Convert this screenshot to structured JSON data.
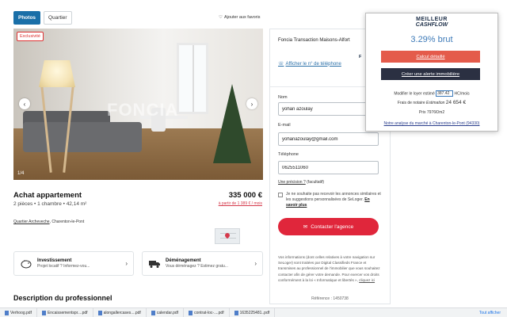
{
  "tabs": [
    "Photos",
    "Quartier"
  ],
  "favorite": "Ajouter aux favoris",
  "photo": {
    "badge": "Exclusivité",
    "counter": "1/4",
    "watermark": "FONCIA"
  },
  "listing": {
    "title": "Achat appartement",
    "details": "2 pièces • 1 chambre • 42,14 m²",
    "price": "335 000 €",
    "loan": "à partir de 1 389 € / mois",
    "location_link": "Quartier Archeveche",
    "location_city": ", Charenton-le-Pont"
  },
  "cards": [
    {
      "title": "Investissement",
      "subtitle": "Projet locatif ? Informez-vou..."
    },
    {
      "title": "Déménagement",
      "subtitle": "Vous déménagez ? Estimez gratu..."
    }
  ],
  "section_title": "Description du professionnel",
  "agency": {
    "name": "Foncia Transaction Maisons-Alfort",
    "logo": "F",
    "phone_link": "Afficher le n° de téléphone"
  },
  "form": {
    "name_label": "Nom",
    "name_value": "yohan azoulay",
    "email_label": "E-mail",
    "email_value": "yohanazoulay@gmail.com",
    "phone_label": "Téléphone",
    "phone_value": "0625511060",
    "precision_link": "Une précision ?",
    "precision_optional": " (facultatif)",
    "consent_text": "Je ne souhaite pas recevoir les annonces similaires et les suggestions personnalisées de SeLoger.",
    "consent_more": "En savoir plus",
    "contact_button": "Contacter l'agence",
    "legal_text": "Vos informations (dont celles relatives à votre navigation sur SeLoger) sont traitées par Digital Classifieds France et transmises au professionnel de l'immobilier que vous souhaitez contacter afin de gérer votre demande. Pour exercer vos droits conformément à la loi « Informatique et libertés »,",
    "legal_link": "cliquez ici",
    "reference": "Référence : 1450738"
  },
  "extension": {
    "logo_line1": "MEILLEUR",
    "logo_line2": "CASHFLOW",
    "yield": "3.29% brut",
    "detail_button": "Calcul détaillé",
    "alert_button": "Créer une alerte immobilière",
    "rent_label": "Modifier le loyer estimé",
    "rent_value": "387.42",
    "rent_unit": "HC/mois",
    "notary_label": "Frais de notaire",
    "notary_estimation": " Estimation ",
    "notary_value": "24 654 €",
    "price_m2": "Prix 7976€/m2",
    "analysis_link": "Notre analyse du marché à Charenton-le-Pont (94330)"
  },
  "downloads": {
    "items": [
      "Verhoog.pdf",
      "Encaissementspr....pdf",
      "alongallercases....pdf",
      "calendar.pdf",
      "contrat-loc-....pdf",
      "1635225481..pdf"
    ],
    "show_all": "Tout afficher"
  },
  "colors": {
    "accent": "#1a6fa8",
    "contact": "#e0263b",
    "extension_red": "#e45b4b",
    "extension_dark": "#2b3042",
    "yield_blue": "#3d7ab8"
  }
}
